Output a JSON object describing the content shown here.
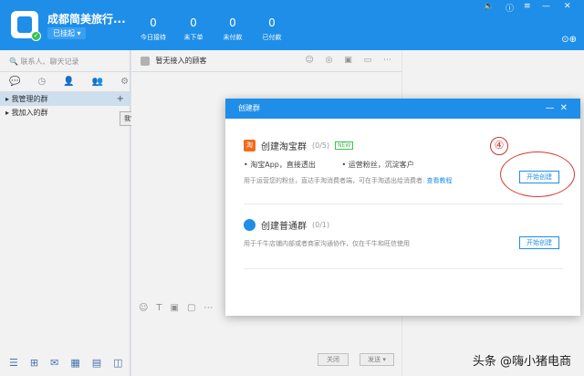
{
  "header": {
    "shop_name": "成都简美旅行...",
    "status": "已挂起",
    "stats": [
      {
        "value": "0",
        "label": "今日接待"
      },
      {
        "value": "0",
        "label": "未下单"
      },
      {
        "value": "0",
        "label": "未付款"
      },
      {
        "value": "0",
        "label": "已付款"
      }
    ]
  },
  "sidebar": {
    "search_placeholder": "联系人、聊天记录",
    "groups": [
      {
        "label": "我管理的群",
        "selected": true
      },
      {
        "label": "我加入的群",
        "selected": false
      }
    ],
    "tooltip": "我管理的群"
  },
  "chat": {
    "head_title": "暂无接入的顾客",
    "close_label": "关闭",
    "send_label": "发送"
  },
  "dialog": {
    "title": "创建群",
    "taobao": {
      "icon_text": "淘",
      "title": "创建淘宝群",
      "count": "(0/5)",
      "badge": "NEW",
      "bullet1": "• 淘宝App，直接透出",
      "bullet2": "• 运营粉丝，沉淀客户",
      "desc": "用于运营您的粉丝，直达手淘消费者端，可在手淘透出给消费者.",
      "link": "查看教程",
      "button": "开始创建"
    },
    "normal": {
      "title": "创建普通群",
      "count": "(0/1)",
      "desc": "用于千牛店铺内部或者商家沟通协作，仅在千牛和旺信使用",
      "button": "开始创建"
    }
  },
  "annotation": {
    "step": "④"
  },
  "watermark": "头条 @嗨小猪电商"
}
